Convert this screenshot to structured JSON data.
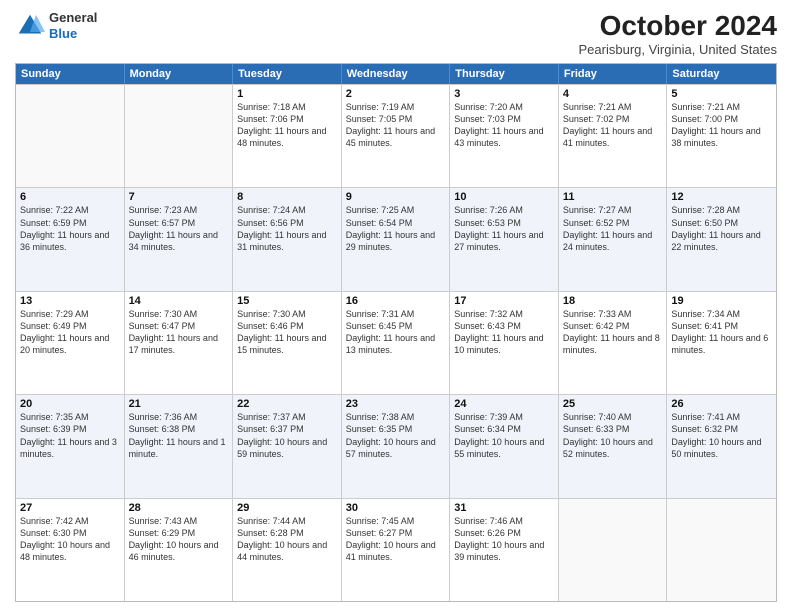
{
  "header": {
    "logo": {
      "general": "General",
      "blue": "Blue"
    },
    "title": "October 2024",
    "location": "Pearisburg, Virginia, United States"
  },
  "days_of_week": [
    "Sunday",
    "Monday",
    "Tuesday",
    "Wednesday",
    "Thursday",
    "Friday",
    "Saturday"
  ],
  "weeks": [
    [
      {
        "day": "",
        "info": "",
        "empty": true
      },
      {
        "day": "",
        "info": "",
        "empty": true
      },
      {
        "day": "1",
        "info": "Sunrise: 7:18 AM\nSunset: 7:06 PM\nDaylight: 11 hours and 48 minutes."
      },
      {
        "day": "2",
        "info": "Sunrise: 7:19 AM\nSunset: 7:05 PM\nDaylight: 11 hours and 45 minutes."
      },
      {
        "day": "3",
        "info": "Sunrise: 7:20 AM\nSunset: 7:03 PM\nDaylight: 11 hours and 43 minutes."
      },
      {
        "day": "4",
        "info": "Sunrise: 7:21 AM\nSunset: 7:02 PM\nDaylight: 11 hours and 41 minutes."
      },
      {
        "day": "5",
        "info": "Sunrise: 7:21 AM\nSunset: 7:00 PM\nDaylight: 11 hours and 38 minutes."
      }
    ],
    [
      {
        "day": "6",
        "info": "Sunrise: 7:22 AM\nSunset: 6:59 PM\nDaylight: 11 hours and 36 minutes."
      },
      {
        "day": "7",
        "info": "Sunrise: 7:23 AM\nSunset: 6:57 PM\nDaylight: 11 hours and 34 minutes."
      },
      {
        "day": "8",
        "info": "Sunrise: 7:24 AM\nSunset: 6:56 PM\nDaylight: 11 hours and 31 minutes."
      },
      {
        "day": "9",
        "info": "Sunrise: 7:25 AM\nSunset: 6:54 PM\nDaylight: 11 hours and 29 minutes."
      },
      {
        "day": "10",
        "info": "Sunrise: 7:26 AM\nSunset: 6:53 PM\nDaylight: 11 hours and 27 minutes."
      },
      {
        "day": "11",
        "info": "Sunrise: 7:27 AM\nSunset: 6:52 PM\nDaylight: 11 hours and 24 minutes."
      },
      {
        "day": "12",
        "info": "Sunrise: 7:28 AM\nSunset: 6:50 PM\nDaylight: 11 hours and 22 minutes."
      }
    ],
    [
      {
        "day": "13",
        "info": "Sunrise: 7:29 AM\nSunset: 6:49 PM\nDaylight: 11 hours and 20 minutes."
      },
      {
        "day": "14",
        "info": "Sunrise: 7:30 AM\nSunset: 6:47 PM\nDaylight: 11 hours and 17 minutes."
      },
      {
        "day": "15",
        "info": "Sunrise: 7:30 AM\nSunset: 6:46 PM\nDaylight: 11 hours and 15 minutes."
      },
      {
        "day": "16",
        "info": "Sunrise: 7:31 AM\nSunset: 6:45 PM\nDaylight: 11 hours and 13 minutes."
      },
      {
        "day": "17",
        "info": "Sunrise: 7:32 AM\nSunset: 6:43 PM\nDaylight: 11 hours and 10 minutes."
      },
      {
        "day": "18",
        "info": "Sunrise: 7:33 AM\nSunset: 6:42 PM\nDaylight: 11 hours and 8 minutes."
      },
      {
        "day": "19",
        "info": "Sunrise: 7:34 AM\nSunset: 6:41 PM\nDaylight: 11 hours and 6 minutes."
      }
    ],
    [
      {
        "day": "20",
        "info": "Sunrise: 7:35 AM\nSunset: 6:39 PM\nDaylight: 11 hours and 3 minutes."
      },
      {
        "day": "21",
        "info": "Sunrise: 7:36 AM\nSunset: 6:38 PM\nDaylight: 11 hours and 1 minute."
      },
      {
        "day": "22",
        "info": "Sunrise: 7:37 AM\nSunset: 6:37 PM\nDaylight: 10 hours and 59 minutes."
      },
      {
        "day": "23",
        "info": "Sunrise: 7:38 AM\nSunset: 6:35 PM\nDaylight: 10 hours and 57 minutes."
      },
      {
        "day": "24",
        "info": "Sunrise: 7:39 AM\nSunset: 6:34 PM\nDaylight: 10 hours and 55 minutes."
      },
      {
        "day": "25",
        "info": "Sunrise: 7:40 AM\nSunset: 6:33 PM\nDaylight: 10 hours and 52 minutes."
      },
      {
        "day": "26",
        "info": "Sunrise: 7:41 AM\nSunset: 6:32 PM\nDaylight: 10 hours and 50 minutes."
      }
    ],
    [
      {
        "day": "27",
        "info": "Sunrise: 7:42 AM\nSunset: 6:30 PM\nDaylight: 10 hours and 48 minutes."
      },
      {
        "day": "28",
        "info": "Sunrise: 7:43 AM\nSunset: 6:29 PM\nDaylight: 10 hours and 46 minutes."
      },
      {
        "day": "29",
        "info": "Sunrise: 7:44 AM\nSunset: 6:28 PM\nDaylight: 10 hours and 44 minutes."
      },
      {
        "day": "30",
        "info": "Sunrise: 7:45 AM\nSunset: 6:27 PM\nDaylight: 10 hours and 41 minutes."
      },
      {
        "day": "31",
        "info": "Sunrise: 7:46 AM\nSunset: 6:26 PM\nDaylight: 10 hours and 39 minutes."
      },
      {
        "day": "",
        "info": "",
        "empty": true
      },
      {
        "day": "",
        "info": "",
        "empty": true
      }
    ]
  ]
}
